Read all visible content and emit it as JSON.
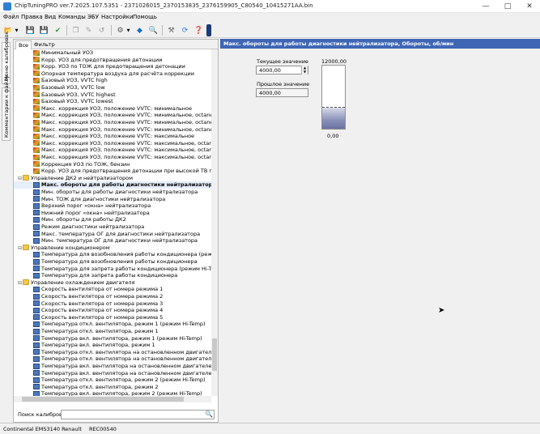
{
  "window": {
    "title": "ChipTuningPRO ver.7.2025.107.5351 - 2371026015_2370153835_2376159905_C80540_10415271AA.bin"
  },
  "menu": [
    "Файл",
    "Правка",
    "Вид",
    "Команды",
    "ЭБУ",
    "Настройки",
    "Помощь"
  ],
  "side_tabs": [
    "Меню калибровок",
    "Комментарии к файлу"
  ],
  "filter_tabs": [
    "Все",
    "Фильтр"
  ],
  "tree": [
    {
      "level": 2,
      "icon": "chart",
      "label": "Минимальный УОЗ"
    },
    {
      "level": 2,
      "icon": "chart",
      "label": "Корр. УОЗ для предотвращения детонации"
    },
    {
      "level": 2,
      "icon": "chart",
      "label": "Корр. УОЗ по ТОЖ для предотвращения детонации"
    },
    {
      "level": 2,
      "icon": "chart",
      "label": "Опорная температура воздуха для расчёта коррекции"
    },
    {
      "level": 2,
      "icon": "chart",
      "label": "Базовый УОЗ, VVTC high"
    },
    {
      "level": 2,
      "icon": "chart",
      "label": "Базовый УОЗ, VVTC low"
    },
    {
      "level": 2,
      "icon": "chart",
      "label": "Базовый УОЗ, VVTC highest"
    },
    {
      "level": 2,
      "icon": "chart",
      "label": "Базовый УОЗ, VVTC lowest"
    },
    {
      "level": 2,
      "icon": "chart",
      "label": "Макс. коррекция УОЗ, положение VVTC: минимальное"
    },
    {
      "level": 2,
      "icon": "chart",
      "label": "Макс. коррекция УОЗ, положение VVTC: минимальное, octane: high"
    },
    {
      "level": 2,
      "icon": "chart",
      "label": "Макс. коррекция УОЗ, положение VVTC: минимальное, octane: high"
    },
    {
      "level": 2,
      "icon": "chart",
      "label": "Макс. коррекция УОЗ, положение VVTC: минимальное, octane: low"
    },
    {
      "level": 2,
      "icon": "chart",
      "label": "Макс. коррекция УОЗ, положение VVTC: максимальное"
    },
    {
      "level": 2,
      "icon": "chart",
      "label": "Макс. коррекция УОЗ, положение VVTC: максимальное, octane: high"
    },
    {
      "level": 2,
      "icon": "chart",
      "label": "Макс. коррекция УОЗ, положение VVTC: максимальное, octane: high"
    },
    {
      "level": 2,
      "icon": "chart",
      "label": "Макс. коррекция УОЗ, положение VVTC: максимальное, octane: low"
    },
    {
      "level": 2,
      "icon": "chart",
      "label": "Коррекция УОЗ по ТОЖ, бензин"
    },
    {
      "level": 2,
      "icon": "chart",
      "label": "Корр. УОЗ для предотвращения детонации при высокой ТВ при трогании"
    },
    {
      "level": 1,
      "icon": "folder",
      "label": "Управление ДК2 и нейтрализатором",
      "expander": "minus"
    },
    {
      "level": 2,
      "icon": "oneD",
      "label": "Макс. обороты для работы диагностики нейтрализатора",
      "selected": true
    },
    {
      "level": 2,
      "icon": "oneD",
      "label": "Мин. обороты для работы диагностики нейтрализатора"
    },
    {
      "level": 2,
      "icon": "oneD",
      "label": "Мин. ТОЖ для диагностики нейтрализатора"
    },
    {
      "level": 2,
      "icon": "oneD",
      "label": "Верхний порог «окна» нейтрализатора"
    },
    {
      "level": 2,
      "icon": "oneD",
      "label": "Нижний порог «окна» нейтрализатора"
    },
    {
      "level": 2,
      "icon": "oneD",
      "label": "Мин. обороты для работы ДК2"
    },
    {
      "level": 2,
      "icon": "oneD",
      "label": "Режим диагностики нейтрализатора"
    },
    {
      "level": 2,
      "icon": "oneD",
      "label": "Макс. температура ОГ для диагностики нейтрализатора"
    },
    {
      "level": 2,
      "icon": "oneD",
      "label": "Мин. температура ОГ для диагностики нейтрализатора"
    },
    {
      "level": 1,
      "icon": "folder",
      "label": "Управление кондиционером",
      "expander": "minus"
    },
    {
      "level": 2,
      "icon": "oneD",
      "label": "Температура для возобновления работы кондиционера (режим Hi-Temp)"
    },
    {
      "level": 2,
      "icon": "oneD",
      "label": "Температура для возобновления работы кондиционера"
    },
    {
      "level": 2,
      "icon": "oneD",
      "label": "Температура для запрета работы кондиционера (режим Hi-Temp)"
    },
    {
      "level": 2,
      "icon": "oneD",
      "label": "Температура для запрета работы кондиционера"
    },
    {
      "level": 1,
      "icon": "folder",
      "label": "Управление охлаждением двигателя",
      "expander": "minus"
    },
    {
      "level": 2,
      "icon": "oneD",
      "label": "Скорость вентилятора от номера режима 1"
    },
    {
      "level": 2,
      "icon": "oneD",
      "label": "Скорость вентилятора от номера режима 2"
    },
    {
      "level": 2,
      "icon": "oneD",
      "label": "Скорость вентилятора от номера режима 3"
    },
    {
      "level": 2,
      "icon": "oneD",
      "label": "Скорость вентилятора от номера режима 4"
    },
    {
      "level": 2,
      "icon": "oneD",
      "label": "Скорость вентилятора от номера режима 5"
    },
    {
      "level": 2,
      "icon": "oneD",
      "label": "Температура откл. вентилятора, режим 1 (режим Hi-Temp)"
    },
    {
      "level": 2,
      "icon": "oneD",
      "label": "Температура откл. вентилятора, режим 1"
    },
    {
      "level": 2,
      "icon": "oneD",
      "label": "Температура вкл. вентилятора, режим 1 (режим Hi-Temp)"
    },
    {
      "level": 2,
      "icon": "oneD",
      "label": "Температура вкл. вентилятора, режим 1"
    },
    {
      "level": 2,
      "icon": "oneD",
      "label": "Температура откл. вентилятора на остановленном двигателе (режим Hi-Temp)"
    },
    {
      "level": 2,
      "icon": "oneD",
      "label": "Температура откл. вентилятора на остановленном двигателе"
    },
    {
      "level": 2,
      "icon": "oneD",
      "label": "Температура вкл. вентилятора на остановленном двигателе (режим Hi-Temp)"
    },
    {
      "level": 2,
      "icon": "oneD",
      "label": "Температура вкл. вентилятора на остановленном двигателе"
    },
    {
      "level": 2,
      "icon": "oneD",
      "label": "Температура откл. вентилятора, режим 2 (режим Hi-Temp)"
    },
    {
      "level": 2,
      "icon": "oneD",
      "label": "Температура откл. вентилятора, режим 2"
    },
    {
      "level": 2,
      "icon": "oneD",
      "label": "Температура вкл. вентилятора, режим 2 (режим Hi-Temp)"
    },
    {
      "level": 2,
      "icon": "oneD",
      "label": "Температура вкл. вентилятора, режим 2"
    }
  ],
  "search": {
    "label": "Поиск калибровки",
    "value": ""
  },
  "param": {
    "header": "Макс. обороты для работы диагностики нейтрализатора, Обороты, об/мин",
    "current_label": "Текущее значение",
    "current_value": "4000,00",
    "previous_label": "Прошлое значение",
    "previous_value": "4000,00",
    "gauge_max": "12000,00",
    "gauge_min": "0,00",
    "gauge_level": 0.333
  },
  "status": [
    "Continental EMS3140 Renault",
    "REC00540"
  ]
}
